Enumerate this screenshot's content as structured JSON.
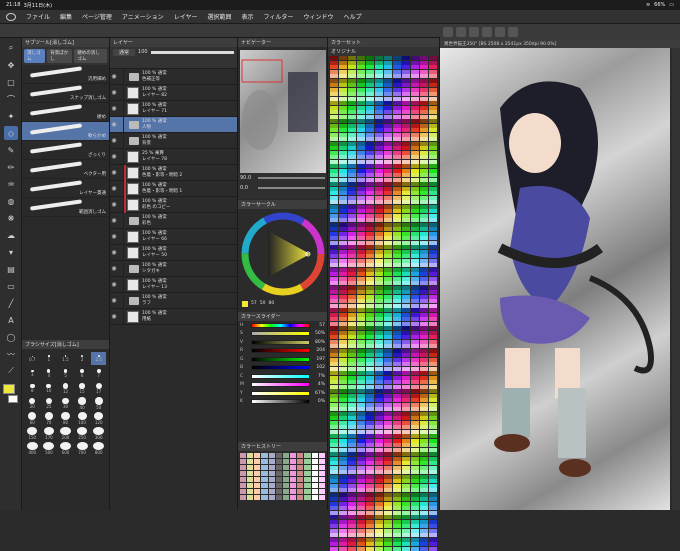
{
  "status": {
    "time": "21:18",
    "date": "3月11日(木)",
    "battery": "66%"
  },
  "menu": [
    "ファイル",
    "編集",
    "ページ管理",
    "アニメーション",
    "レイヤー",
    "選択範囲",
    "表示",
    "フィルター",
    "ウィンドウ",
    "ヘルプ"
  ],
  "brush_panel": {
    "title": "サブツール[消しゴム]",
    "tabs": [
      "消しゴム",
      "背景ぼかし",
      "硬めの消しゴム"
    ],
    "brushes": [
      {
        "name": "汎用細め",
        "sel": false
      },
      {
        "name": "スナップ消しゴム",
        "sel": false
      },
      {
        "name": "硬め",
        "sel": false
      },
      {
        "name": "軟らかめ",
        "sel": true
      },
      {
        "name": "ざっくり",
        "sel": false
      },
      {
        "name": "ベクター用",
        "sel": false
      },
      {
        "name": "レイヤー貫通",
        "sel": false
      },
      {
        "name": "範囲消しゴム",
        "sel": false
      }
    ]
  },
  "size_panel": {
    "title": "ブラシサイズ[消しゴム]",
    "sizes": [
      "0.7",
      "1",
      "1.5",
      "2",
      "2.5",
      "3",
      "4",
      "5",
      "6",
      "7",
      "8",
      "10",
      "12",
      "15",
      "17",
      "20",
      "25",
      "30",
      "40",
      "50",
      "60",
      "70",
      "80",
      "100",
      "120",
      "150",
      "170",
      "200",
      "250",
      "300",
      "400",
      "500",
      "600",
      "700",
      "800"
    ]
  },
  "layer_panel": {
    "title": "レイヤー",
    "blend": "通常",
    "opacity": "100",
    "layers": [
      {
        "t1": "100 % 通常",
        "t2": "色補正等",
        "type": "folder",
        "sel": false
      },
      {
        "t1": "100 % 通常",
        "t2": "レイヤー 82",
        "type": "layer",
        "sel": false
      },
      {
        "t1": "100 % 通常",
        "t2": "レイヤー 71",
        "type": "layer",
        "sel": false
      },
      {
        "t1": "100 % 通常",
        "t2": "人物",
        "type": "folder",
        "sel": true
      },
      {
        "t1": "100 % 通常",
        "t2": "背景",
        "type": "folder",
        "sel": false
      },
      {
        "t1": "25 % 乗算",
        "t2": "レイヤー 78",
        "type": "layer",
        "sel": false
      },
      {
        "t1": "100 % 通常",
        "t2": "色着・影等・明暗 2",
        "type": "layer",
        "sel": false
      },
      {
        "t1": "100 % 通常",
        "t2": "色着・影等・明暗 1",
        "type": "layer",
        "sel": false
      },
      {
        "t1": "100 % 通常",
        "t2": "彩色 のコピー",
        "type": "layer",
        "sel": false
      },
      {
        "t1": "100 % 通常",
        "t2": "彩色",
        "type": "folder",
        "sel": false
      },
      {
        "t1": "100 % 通常",
        "t2": "レイヤー 66",
        "type": "layer",
        "sel": false
      },
      {
        "t1": "100 % 通常",
        "t2": "レイヤー 50",
        "type": "layer",
        "sel": false
      },
      {
        "t1": "100 % 通常",
        "t2": "シタガキ",
        "type": "folder",
        "sel": false
      },
      {
        "t1": "100 % 通常",
        "t2": "レイヤー 13",
        "type": "layer",
        "sel": false
      },
      {
        "t1": "100 % 通常",
        "t2": "ラフ",
        "type": "folder",
        "sel": false
      },
      {
        "t1": "100 % 通常",
        "t2": "用紙",
        "type": "layer",
        "sel": false
      }
    ]
  },
  "navigator": {
    "title": "ナビゲーター",
    "zoom": "90.0",
    "angle": "0.0"
  },
  "color_wheel": {
    "title": "カラーサークル",
    "h": "57",
    "s": "50",
    "v": "80"
  },
  "color_slider": {
    "title": "カラースライダー",
    "rows": [
      {
        "lab": "H",
        "val": "57",
        "grad": "linear-gradient(90deg,#f00,#ff0,#0f0,#0ff,#00f,#f0f,#f00)"
      },
      {
        "lab": "S",
        "val": "50%",
        "grad": "linear-gradient(90deg,#aaa,#ff0)"
      },
      {
        "lab": "V",
        "val": "80%",
        "grad": "linear-gradient(90deg,#000,#cc6)"
      },
      {
        "lab": "R",
        "val": "204",
        "grad": "linear-gradient(90deg,#000,#f00)"
      },
      {
        "lab": "G",
        "val": "197",
        "grad": "linear-gradient(90deg,#000,#0f0)"
      },
      {
        "lab": "B",
        "val": "102",
        "grad": "linear-gradient(90deg,#000,#00f)"
      },
      {
        "lab": "C",
        "val": "7%",
        "grad": "linear-gradient(90deg,#fff,#0ff)"
      },
      {
        "lab": "M",
        "val": "4%",
        "grad": "linear-gradient(90deg,#fff,#f0f)"
      },
      {
        "lab": "Y",
        "val": "67%",
        "grad": "linear-gradient(90deg,#fff,#ff0)"
      },
      {
        "lab": "K",
        "val": "0%",
        "grad": "linear-gradient(90deg,#fff,#000)"
      }
    ]
  },
  "history": {
    "title": "カラーヒストリー"
  },
  "color_set": {
    "title": "カラーセット",
    "set_name": "オリジナル"
  },
  "canvas": {
    "tab": "異世界猫王350° [BS 2508 x 3541px 350dpi 90.0%]"
  },
  "colors": {
    "accent": "#5574a8",
    "fg": "#f0e640",
    "bg": "#ffffff"
  }
}
